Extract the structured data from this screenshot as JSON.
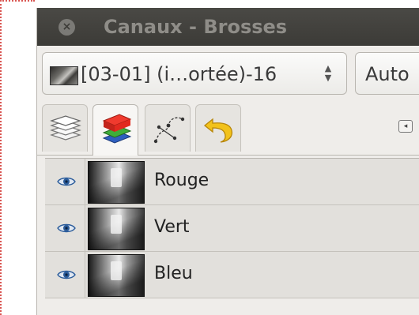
{
  "window": {
    "title": "Canaux - Brosses",
    "close_symbol": "×"
  },
  "image_selector": {
    "label": "[03-01] (i…ortée)-16",
    "arrows": "▲▼"
  },
  "auto_button": {
    "label": "Auto"
  },
  "tabs": [
    {
      "icon": "layers-icon",
      "active": false
    },
    {
      "icon": "channels-icon",
      "active": true
    },
    {
      "icon": "paths-icon",
      "active": false
    },
    {
      "icon": "undo-history-icon",
      "active": false
    }
  ],
  "tab_menu_arrow": "◂",
  "channels": [
    {
      "name": "Rouge",
      "visible": true
    },
    {
      "name": "Vert",
      "visible": true
    },
    {
      "name": "Bleu",
      "visible": true
    }
  ],
  "colors": {
    "titlebar": "#3c3b37",
    "panel": "#efedea",
    "row": "#e2e0dc",
    "eye": "#2a5b9a"
  }
}
